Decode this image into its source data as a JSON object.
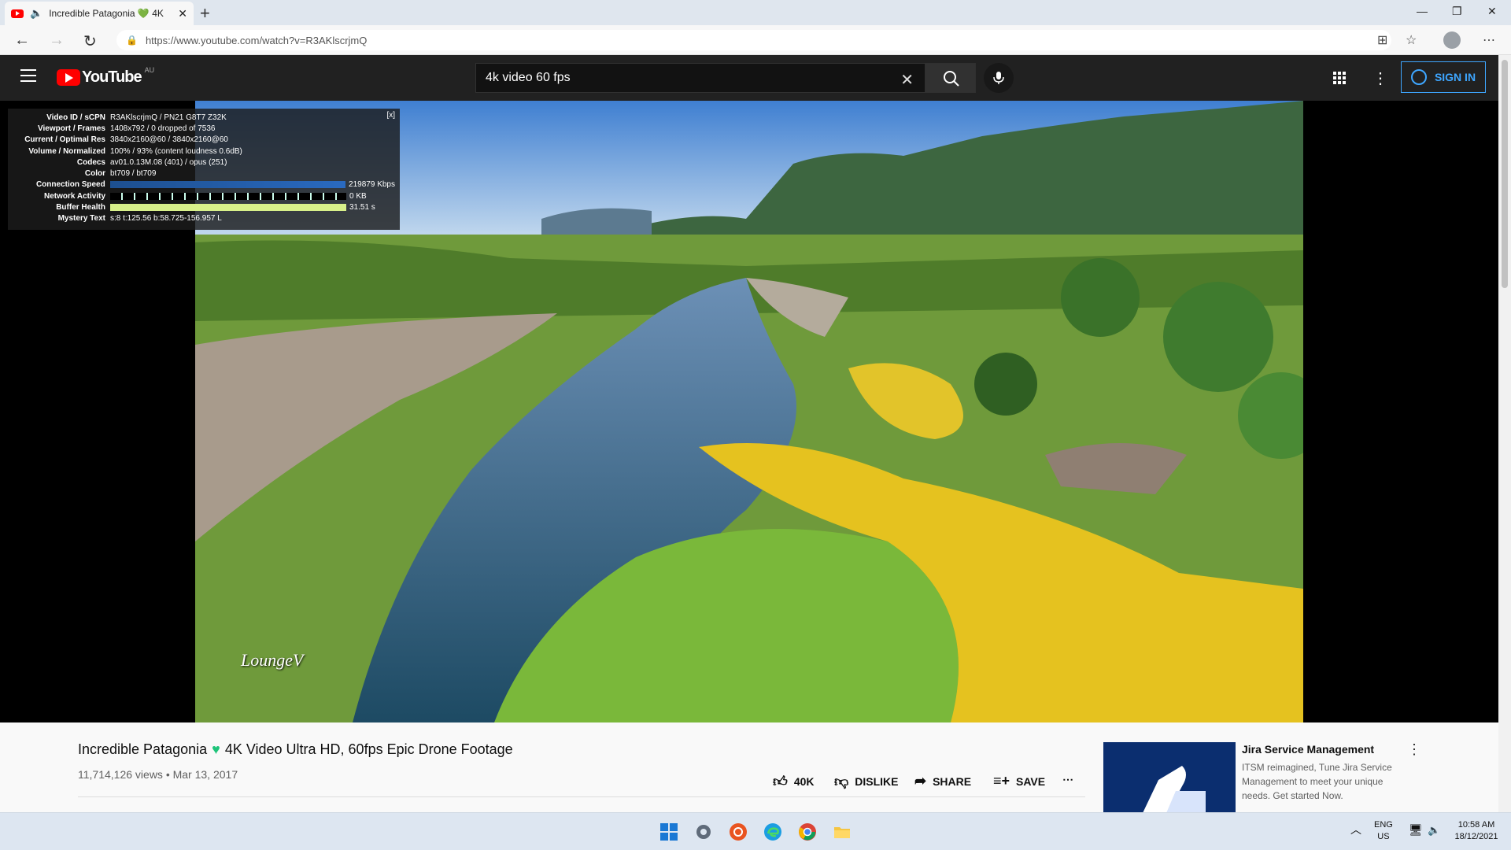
{
  "browser": {
    "tab_title": "Incredible Patagonia 💚 4K",
    "url": "https://www.youtube.com/watch?v=R3AKlscrjmQ"
  },
  "masthead": {
    "logo_text": "YouTube",
    "country": "AU",
    "search_value": "4k video 60 fps",
    "signin_label": "SIGN IN"
  },
  "stats": {
    "rows": [
      {
        "key": "Video ID / sCPN",
        "value": "R3AKlscrjmQ / PN21 G8T7 Z32K"
      },
      {
        "key": "Viewport / Frames",
        "value": "1408x792 / 0 dropped of 7536"
      },
      {
        "key": "Current / Optimal Res",
        "value": "3840x2160@60 / 3840x2160@60"
      },
      {
        "key": "Volume / Normalized",
        "value": "100% / 93% (content loudness 0.6dB)"
      },
      {
        "key": "Codecs",
        "value": "av01.0.13M.08 (401) / opus (251)"
      },
      {
        "key": "Color",
        "value": "bt709 / bt709"
      }
    ],
    "connection_label": "Connection Speed",
    "connection_value": "219879 Kbps",
    "network_label": "Network Activity",
    "network_value": "0 KB",
    "buffer_label": "Buffer Health",
    "buffer_value": "31.51 s",
    "mystery_label": "Mystery Text",
    "mystery_value": "s:8 t:125.56 b:58.725-156.957 L",
    "close_label": "[x]"
  },
  "player": {
    "watermark": "LoungeV"
  },
  "video": {
    "title_a": "Incredible Patagonia",
    "title_b": "4K Video Ultra HD, 60fps Epic Drone Footage",
    "meta": "11,714,126 views • Mar 13, 2017",
    "like_count": "40K",
    "dislike_label": "DISLIKE",
    "share_label": "SHARE",
    "save_label": "SAVE"
  },
  "ad": {
    "title": "Jira Service Management",
    "description": "ITSM reimagined, Tune Jira Service Management to meet your unique needs. Get started Now."
  },
  "taskbar": {
    "lang": "ENG",
    "region": "US",
    "time": "10:58 AM",
    "date": "18/12/2021"
  }
}
